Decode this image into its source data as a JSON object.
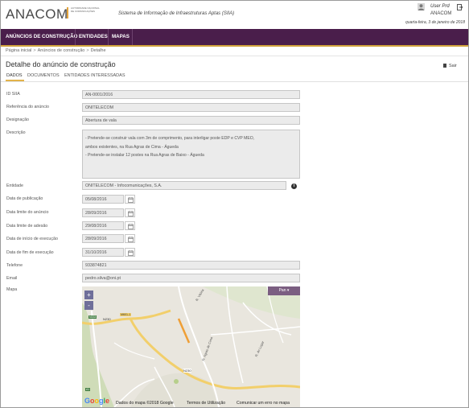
{
  "header": {
    "logo_text": "ANACOM",
    "logo_subtitle": "AUTORIDADE NACIONAL DE COMUNICAÇÕES",
    "system_name": "Sistema de Informação de Infraestruturas Aptas (SIIA)",
    "user_name": "User Prd",
    "user_org": "ANACOM",
    "date": "quarta-feira, 3 de janeiro de 2018"
  },
  "nav": {
    "items": [
      {
        "label": "ANÚNCIOS DE CONSTRUÇÃO"
      },
      {
        "label": "ENTIDADES"
      },
      {
        "label": "MAPAS"
      }
    ],
    "accent": "#4a1e4b",
    "accent_border": "#d1a33c"
  },
  "breadcrumb": [
    "Página inicial",
    "Anúncios de construção",
    "Detalhe"
  ],
  "page": {
    "title": "Detalhe do anúncio de construção",
    "exit_label": "Sair"
  },
  "tabs": [
    "DADOS",
    "DOCUMENTOS",
    "ENTIDADES INTERESSADAS"
  ],
  "form": {
    "id_siia": {
      "label": "ID SIIA",
      "value": "AN-0001/2016"
    },
    "referencia": {
      "label": "Referência do anúncio",
      "value": "ONITELECOM"
    },
    "designacao": {
      "label": "Designação",
      "value": "Abertura de vala"
    },
    "descricao": {
      "label": "Descrição",
      "lines": [
        "- Pretende-se construir vala com 3m de comprimento, para interligar poste EDP e CVP MEO,",
        "ambos existentes, na Rua Agras de Cima - Águeda",
        "- Pretende-se instalar 12 postes na Rua Agras de Baixo - Águeda"
      ]
    },
    "entidade": {
      "label": "Entidade",
      "value": "ONITELECOM - Infocomunicações, S.A."
    },
    "data_publicacao": {
      "label": "Data de publicação",
      "value": "05/08/2016"
    },
    "data_limite_anuncio": {
      "label": "Data limite do anúncio",
      "value": "28/09/2016"
    },
    "data_limite_adesao": {
      "label": "Data limite de adesão",
      "value": "29/08/2016"
    },
    "data_inicio": {
      "label": "Data de início de execução",
      "value": "28/09/2016"
    },
    "data_fim": {
      "label": "Data de fim de execução",
      "value": "31/10/2016"
    },
    "telefone": {
      "label": "Telefone",
      "value": "933874821"
    },
    "email": {
      "label": "Email",
      "value": "pedro.silva@oni.pt"
    },
    "mapa": {
      "label": "Mapa"
    }
  },
  "map": {
    "zoom_in": "+",
    "zoom_out": "-",
    "pan_label": "Pan ▾",
    "road_labels": [
      "N333",
      "N230",
      "M601-1",
      "R. Vitória",
      "R. Agras de Cima",
      "A1",
      "N230",
      "R. do Lugar"
    ],
    "footer": [
      "Dados do mapa ©2018 Google",
      "Termos de Utilização",
      "Comunicar um erro no mapa"
    ],
    "google": "Google"
  }
}
